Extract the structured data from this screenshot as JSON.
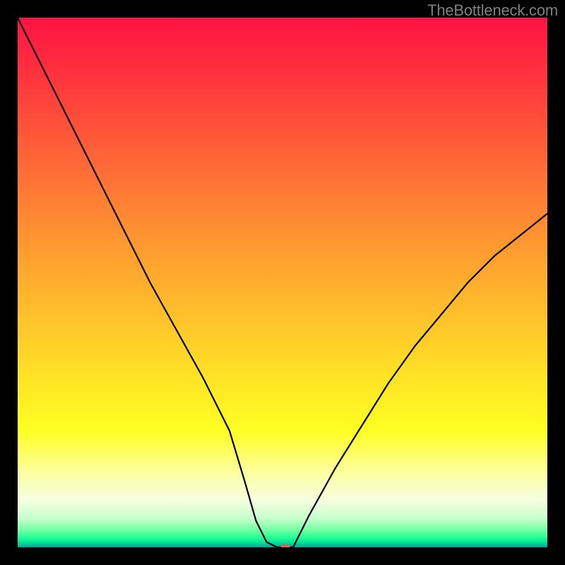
{
  "watermark": "TheBottleneck.com",
  "chart_data": {
    "type": "line",
    "title": "",
    "xlabel": "",
    "ylabel": "",
    "xlim": [
      0,
      100
    ],
    "ylim": [
      0,
      100
    ],
    "grid": false,
    "series": [
      {
        "name": "bottleneck-curve",
        "x": [
          0,
          5,
          10,
          15,
          20,
          25,
          30,
          35,
          40,
          43,
          45,
          47,
          49,
          52,
          55,
          60,
          65,
          70,
          75,
          80,
          85,
          90,
          95,
          100
        ],
        "values": [
          100,
          90,
          80,
          70,
          60,
          50,
          41,
          32,
          22,
          12,
          5,
          1,
          0,
          0,
          6,
          15,
          23,
          31,
          38,
          44,
          50,
          55,
          59,
          63
        ]
      }
    ],
    "marker": {
      "x": 50.5,
      "y": 0
    },
    "background_gradient": {
      "stops": [
        {
          "pos": 0,
          "color": "#ff1344"
        },
        {
          "pos": 0.78,
          "color": "#ffff22"
        },
        {
          "pos": 0.95,
          "color": "#c8ffcc"
        },
        {
          "pos": 1.0,
          "color": "#009f9c"
        }
      ]
    }
  }
}
